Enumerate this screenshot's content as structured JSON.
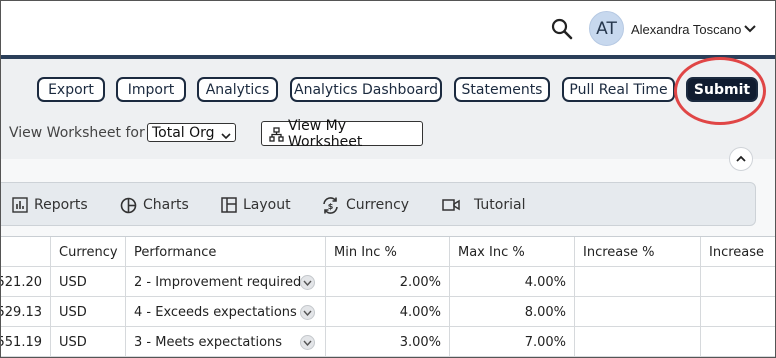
{
  "header": {
    "user_initials": "AT",
    "user_name": "Alexandra Toscano"
  },
  "toolbar": {
    "buttons": [
      "Export",
      "Import",
      "Analytics",
      "Analytics Dashboard",
      "Statements",
      "Pull Real Time"
    ],
    "submit_label": "Submit"
  },
  "worksheet": {
    "label": "View Worksheet for :",
    "selected": "Total Org",
    "my_worksheet_label": "View My Worksheet"
  },
  "tools": {
    "reports": "Reports",
    "charts": "Charts",
    "layout": "Layout",
    "currency": "Currency",
    "tutorial": "Tutorial"
  },
  "table": {
    "headers": [
      "Currency",
      "Performance",
      "Min Inc %",
      "Max Inc %",
      "Increase %",
      "Increase"
    ],
    "rows": [
      {
        "amount": "521.20",
        "currency": "USD",
        "performance": "2 - Improvement required",
        "min": "2.00%",
        "max": "4.00%"
      },
      {
        "amount": "529.13",
        "currency": "USD",
        "performance": "4 - Exceeds expectations",
        "min": "4.00%",
        "max": "8.00%"
      },
      {
        "amount": "551.19",
        "currency": "USD",
        "performance": "3 - Meets expectations",
        "min": "3.00%",
        "max": "7.00%"
      }
    ]
  },
  "colors": {
    "navy": "#1b2a3f",
    "highlight": "#e04646"
  }
}
